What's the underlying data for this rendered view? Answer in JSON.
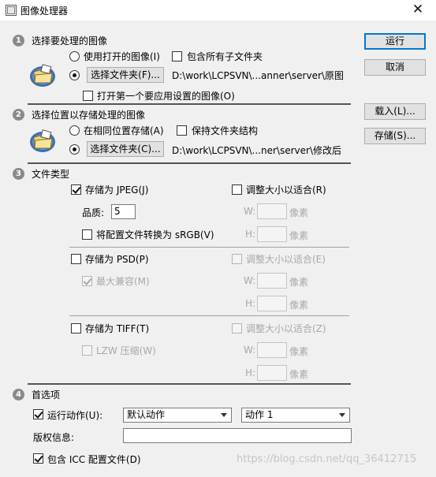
{
  "window": {
    "title": "图像处理器",
    "close_symbol": "✕"
  },
  "sections": {
    "s1": {
      "number": "1",
      "title": "选择要处理的图像",
      "radio_open": "使用打开的图像(I)",
      "checkbox_subfolders": "包含所有子文件夹",
      "select_folder_button": "选择文件夹(F)...",
      "folder_path": "D:\\work\\LCPSVN\\...anner\\server\\原图",
      "checkbox_open_first": "打开第一个要应用设置的图像(O)"
    },
    "s2": {
      "number": "2",
      "title": "选择位置以存储处理的图像",
      "radio_same_location": "在相同位置存储(A)",
      "checkbox_keep_structure": "保持文件夹结构",
      "select_folder_button": "选择文件夹(C)...",
      "folder_path": "D:\\work\\LCPSVN\\...ner\\server\\修改后"
    },
    "s3": {
      "number": "3",
      "title": "文件类型",
      "jpeg": {
        "save_label": "存储为 JPEG(J)",
        "resize_label": "调整大小以适合(R)",
        "quality_label": "品质:",
        "quality_value": "5",
        "w_label": "W:",
        "h_label": "H:",
        "unit": "像素",
        "convert_label": "将配置文件转换为 sRGB(V)"
      },
      "psd": {
        "save_label": "存储为 PSD(P)",
        "resize_label": "调整大小以适合(E)",
        "maximize_label": "最大兼容(M)",
        "w_label": "W:",
        "h_label": "H:",
        "unit": "像素"
      },
      "tiff": {
        "save_label": "存储为 TIFF(T)",
        "resize_label": "调整大小以适合(Z)",
        "lzw_label": "LZW 压缩(W)",
        "w_label": "W:",
        "h_label": "H:",
        "unit": "像素"
      }
    },
    "s4": {
      "number": "4",
      "title": "首选项",
      "run_action_label": "运行动作(U):",
      "action_set": "默认动作",
      "action": "动作 1",
      "copyright_label": "版权信息:",
      "copyright_value": "",
      "icc_label": "包含 ICC 配置文件(D)"
    }
  },
  "buttons": {
    "run": "运行",
    "cancel": "取消",
    "load": "载入(L)...",
    "save": "存储(S)..."
  },
  "watermark": "https://blog.csdn.net/qq_36412715",
  "colors": {
    "default_button_border": "#0078d7",
    "step_badge": "#8a8a8a"
  }
}
